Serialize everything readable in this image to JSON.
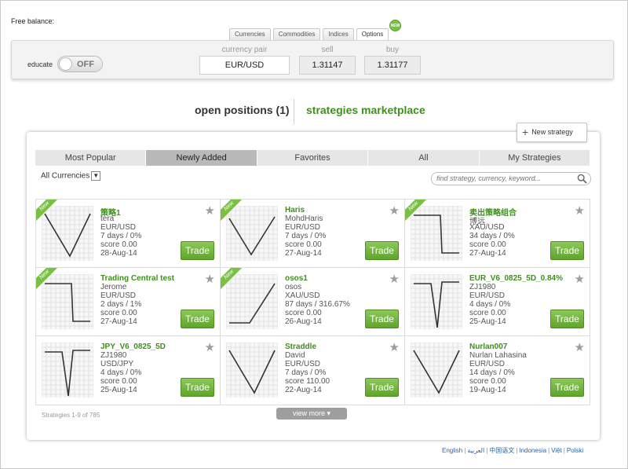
{
  "header": {
    "free_balance_label": "Free balance:"
  },
  "asset_tabs": [
    {
      "label": "Currencies",
      "active": false
    },
    {
      "label": "Commodities",
      "active": false
    },
    {
      "label": "Indices",
      "active": false
    },
    {
      "label": "Options",
      "active": true
    }
  ],
  "options_badge": "NEW",
  "trade_panel": {
    "educate_label": "educate",
    "toggle_text": "OFF",
    "pair_header": "currency pair",
    "pair_value": "EUR/USD",
    "sell_header": "sell",
    "sell_value": "1.31147",
    "buy_header": "buy",
    "buy_value": "1.31177"
  },
  "sections": {
    "open_positions": "open positions (1)",
    "marketplace": "strategies marketplace"
  },
  "new_strategy_label": "New strategy",
  "filters": [
    "Most Popular",
    "Newly Added",
    "Favorites",
    "All",
    "My Strategies"
  ],
  "active_filter": "Newly Added",
  "currency_select": "All Currencies",
  "search_placeholder": "find strategy, currency, keyword...",
  "ribbon_text": "New",
  "trade_label": "Trade",
  "strategies": [
    {
      "name": "策略1",
      "author": "tera",
      "pair": "EUR/USD",
      "perf": "7 days / 0%",
      "score": "score 0.00",
      "date": "28-Aug-14",
      "new": true,
      "shape": "v"
    },
    {
      "name": "Haris",
      "author": "MohdHaris",
      "pair": "EUR/USD",
      "perf": "7 days / 0%",
      "score": "score 0.00",
      "date": "27-Aug-14",
      "new": true,
      "shape": "v2"
    },
    {
      "name": "卖出策略组合",
      "author": "博远",
      "pair": "XAU/USD",
      "perf": "34 days / 0%",
      "score": "score 0.00",
      "date": "27-Aug-14",
      "new": true,
      "shape": "stepdown"
    },
    {
      "name": "Trading Central test",
      "author": "Jerome",
      "pair": "EUR/USD",
      "perf": "2 days / 1%",
      "score": "score 0.00",
      "date": "27-Aug-14",
      "new": true,
      "shape": "stepdown"
    },
    {
      "name": "osos1",
      "author": "osos",
      "pair": "XAU/USD",
      "perf": "87 days / 316.67%",
      "score": "score 0.00",
      "date": "26-Aug-14",
      "new": true,
      "shape": "stepup"
    },
    {
      "name": "EUR_V6_0825_5D_0.84%",
      "author": "ZJ1980",
      "pair": "EUR/USD",
      "perf": "4 days / 0%",
      "score": "score 0.00",
      "date": "25-Aug-14",
      "new": false,
      "shape": "spike"
    },
    {
      "name": "JPY_V6_0825_5D",
      "author": "ZJ1980",
      "pair": "USD/JPY",
      "perf": "4 days / 0%",
      "score": "score 0.00",
      "date": "25-Aug-14",
      "new": false,
      "shape": "spike"
    },
    {
      "name": "Straddle",
      "author": "David",
      "pair": "EUR/USD",
      "perf": "7 days / 0%",
      "score": "score 110.00",
      "date": "22-Aug-14",
      "new": false,
      "shape": "v"
    },
    {
      "name": "Nurlan007",
      "author": "Nurlan Lahasina",
      "pair": "EUR/USD",
      "perf": "14 days / 0%",
      "score": "score 0.00",
      "date": "19-Aug-14",
      "new": false,
      "shape": "v"
    }
  ],
  "footer": {
    "count": "Strategies 1-9 of 785",
    "view_more": "view more"
  },
  "languages": [
    "English",
    "العربية",
    "中国语文",
    "Indonesia",
    "Việt",
    "Polski"
  ]
}
